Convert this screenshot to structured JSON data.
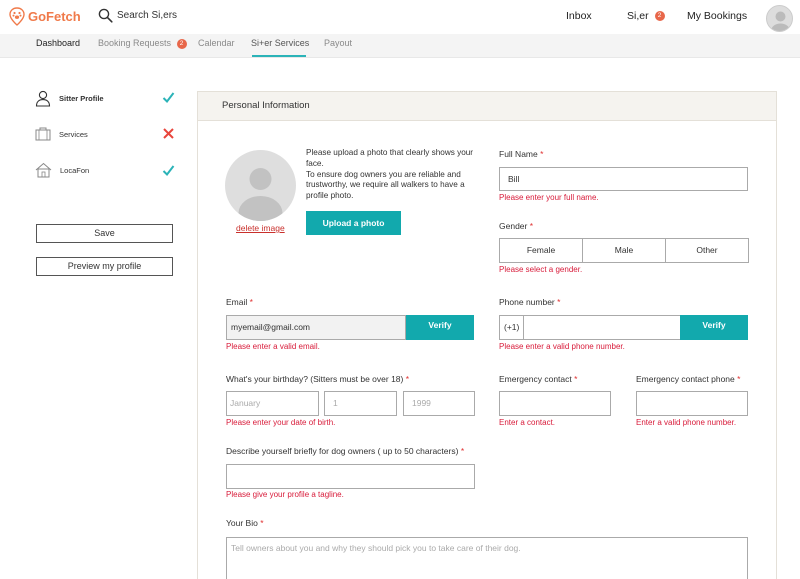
{
  "header": {
    "brand": "GoFetch",
    "search_label": "Search Si,ers",
    "nav": {
      "inbox": "Inbox",
      "sitter": "Si,er",
      "sitter_badge": "2",
      "bookings": "My Bookings"
    }
  },
  "subnav": {
    "tabs": [
      "Dashboard",
      "Booking Requests",
      "Calendar",
      "Si+er Services",
      "Payout"
    ],
    "booking_badge": "2",
    "active_tab": "Si+er Services"
  },
  "sidebar": {
    "items": [
      {
        "label": "Sitter Profile",
        "status": "complete"
      },
      {
        "label": "Services",
        "status": "incomplete"
      },
      {
        "label": "LocaFon",
        "status": "complete"
      }
    ],
    "save_label": "Save",
    "preview_label": "Preview my profile"
  },
  "colors": {
    "brand": "#f07a4a",
    "accent": "#12a9ad",
    "error": "#d81b3a",
    "check": "#2bb3b8",
    "cross": "#e8453c"
  },
  "personal": {
    "title": "Personal Information",
    "photo": {
      "instructions": "Please upload a photo that clearly shows your face.\nTo ensure dog owners you are reliable and trustworthy, we require all walkers to have a profile photo.",
      "upload_label": "Upload a photo",
      "delete_label": "delete image"
    },
    "full_name": {
      "label": "Full Name",
      "req": "*",
      "value": "Bill",
      "error": "Please enter your full name."
    },
    "gender": {
      "label": "Gender",
      "req": "*",
      "options": [
        "Female",
        "Male",
        "Other"
      ],
      "error": "Please select a gender."
    },
    "email": {
      "label": "Email",
      "req": "*",
      "value": "myemail@gmail.com",
      "verify": "Verify",
      "error": "Please enter a valid email."
    },
    "phone": {
      "label": "Phone number",
      "req": "*",
      "prefix": "(+1)",
      "value": "",
      "verify": "Verify",
      "error": "Please enter a valid phone number."
    },
    "birthday": {
      "label": "What's your birthday? (Sitters must be over 18)",
      "req": "*",
      "month_placeholder": "January",
      "day_placeholder": "1",
      "year_placeholder": "1999",
      "error": "Please enter your date of birth."
    },
    "emergency_contact": {
      "label": "Emergency contact",
      "req": "*",
      "value": "",
      "error": "Enter a contact."
    },
    "emergency_phone": {
      "label": "Emergency contact phone",
      "req": "*",
      "value": "",
      "error": "Enter a valid phone number."
    },
    "tagline": {
      "label": "Describe yourself briefly for dog owners ( up to 50 characters)",
      "req": "*",
      "value": "",
      "error": "Please give your profile a tagline."
    },
    "bio": {
      "label": "Your Bio",
      "req": "*",
      "placeholder": "Tell owners about you and why they should pick you to take care of their dog."
    }
  }
}
